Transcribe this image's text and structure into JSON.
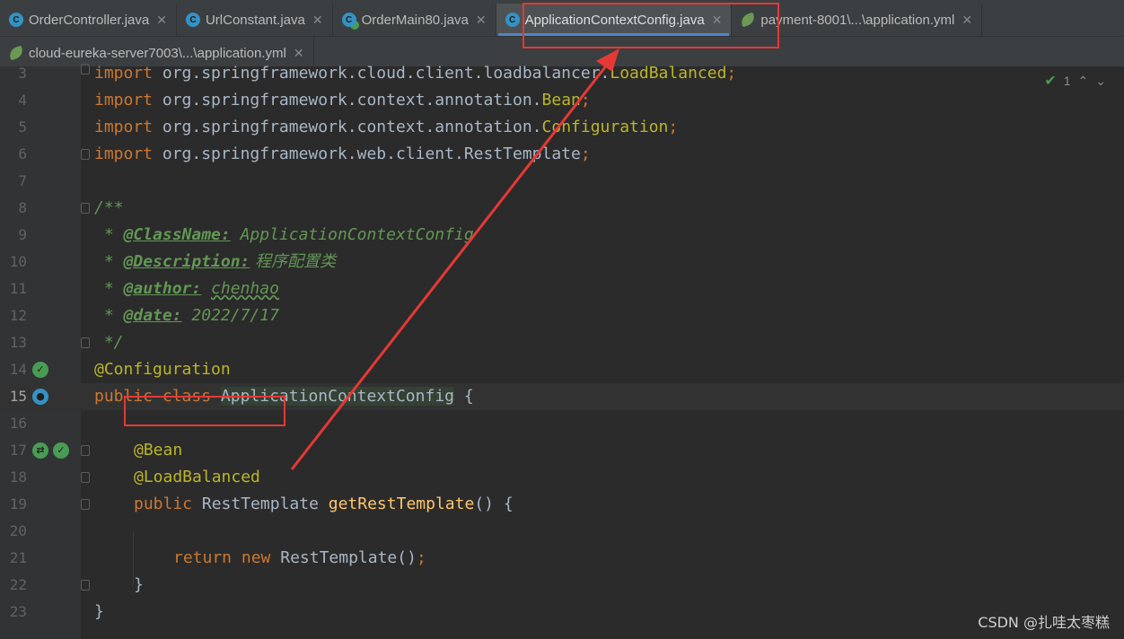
{
  "tabs_row1": [
    {
      "label": "OrderController.java",
      "icon": "java-class-icon"
    },
    {
      "label": "UrlConstant.java",
      "icon": "java-class-icon"
    },
    {
      "label": "OrderMain80.java",
      "icon": "java-main-class-icon"
    },
    {
      "label": "ApplicationContextConfig.java",
      "icon": "java-class-icon",
      "active": true
    },
    {
      "label": "payment-8001\\...\\application.yml",
      "icon": "spring-yml-icon"
    }
  ],
  "tabs_row2": [
    {
      "label": "cloud-eureka-server7003\\...\\application.yml",
      "icon": "spring-yml-icon"
    }
  ],
  "close_glyph": "✕",
  "inspection": {
    "count": "1"
  },
  "lines": {
    "n3": "3",
    "n4": "4",
    "n5": "5",
    "n6": "6",
    "n7": "7",
    "n8": "8",
    "n9": "9",
    "n10": "10",
    "n11": "11",
    "n12": "12",
    "n13": "13",
    "n14": "14",
    "n15": "15",
    "n16": "16",
    "n17": "17",
    "n18": "18",
    "n19": "19",
    "n20": "20",
    "n21": "21",
    "n22": "22",
    "n23": "23"
  },
  "code": {
    "import_kw": "import",
    "l3_pkg": " org.springframework.cloud.client.loadbalancer.",
    "l3_cls": "LoadBalanced",
    "l4_pkg": " org.springframework.context.annotation.",
    "l4_cls": "Bean",
    "l5_pkg": " org.springframework.context.annotation.",
    "l5_cls": "Configuration",
    "l6_pkg": " org.springframework.web.client.RestTemplate",
    "semi": ";",
    "doc_open": "/**",
    "doc_star": " * ",
    "tag_classname": "@ClassName:",
    "val_classname": " ApplicationContextConfig",
    "tag_description": "@Description:",
    "val_description": " 程序配置类",
    "tag_author": "@author:",
    "val_author": "chenhao",
    "tag_date": "@date:",
    "val_date": " 2022/7/17",
    "doc_close": " */",
    "ann_configuration": "@Configuration",
    "kw_public": "public",
    "kw_class": "class",
    "class_name": "ApplicationContextConfig",
    "brace_open": " {",
    "ann_bean": "@Bean",
    "ann_loadbalanced": "@LoadBalanced",
    "type_rest": " RestTemplate ",
    "method_name": "getRestTemplate",
    "method_tail": "() {",
    "kw_return": "return",
    "kw_new": "new",
    "ctor": " RestTemplate()",
    "brace_close": "}"
  },
  "watermark": "CSDN @扎哇太枣糕",
  "colors": {
    "highlight_box": "#e53935",
    "active_tab_underline": "#4a88c7"
  }
}
